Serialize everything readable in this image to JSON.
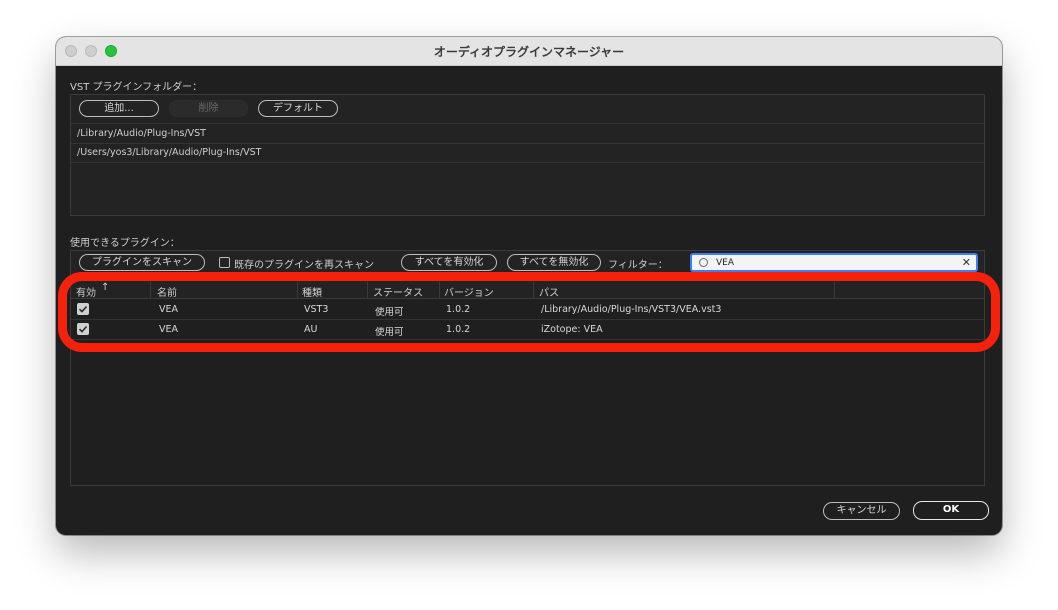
{
  "window": {
    "title": "オーディオプラグインマネージャー"
  },
  "vst_folders": {
    "label": "VST プラグインフォルダー：",
    "buttons": {
      "add": "追加...",
      "delete": "削除",
      "default": "デフォルト"
    },
    "paths": [
      "/Library/Audio/Plug-Ins/VST",
      "/Users/yos3/Library/Audio/Plug-Ins/VST"
    ]
  },
  "plugins": {
    "label": "使用できるプラグイン：",
    "toolbar": {
      "scan": "プラグインをスキャン",
      "rescan_label": "既存のプラグインを再スキャン",
      "enable_all": "すべてを有効化",
      "disable_all": "すべてを無効化",
      "filter_label": "フィルター：",
      "filter_value": "VEA"
    },
    "columns": [
      "有効",
      "名前",
      "種類",
      "ステータス",
      "バージョン",
      "パス"
    ],
    "rows": [
      {
        "enabled": true,
        "name": "VEA",
        "type": "VST3",
        "status": "使用可",
        "version": "1.0.2",
        "path": "/Library/Audio/Plug-Ins/VST3/VEA.vst3"
      },
      {
        "enabled": true,
        "name": "VEA",
        "type": "AU",
        "status": "使用可",
        "version": "1.0.2",
        "path": "iZotope: VEA"
      }
    ]
  },
  "footer": {
    "cancel": "キャンセル",
    "ok": "OK"
  },
  "colors": {
    "highlight": "#f5210d",
    "focus_ring": "#3b7ff2",
    "zoom_button": "#29c43f"
  }
}
